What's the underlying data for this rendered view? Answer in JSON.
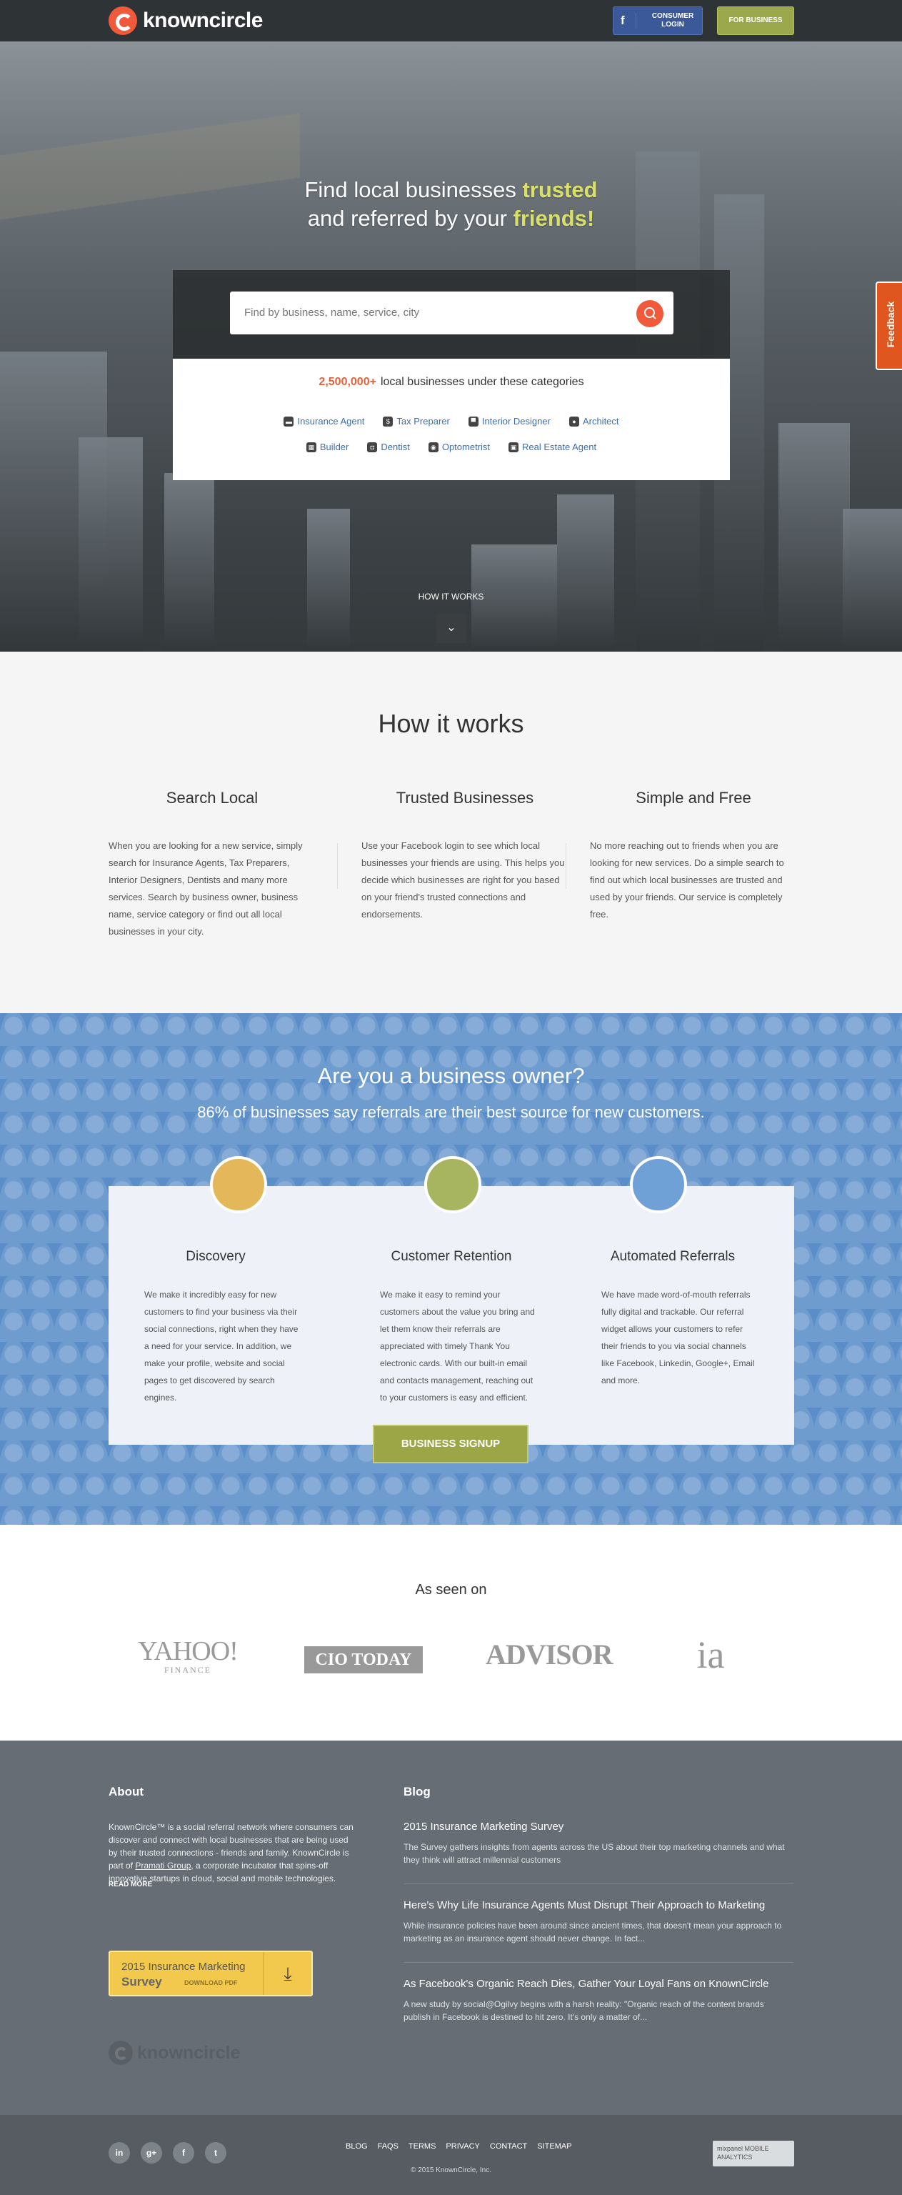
{
  "nav": {
    "logo_text": "knowncircle",
    "fb_label": "CONSUMER LOGIN",
    "business_label": "FOR BUSINESS"
  },
  "hero": {
    "title_part1": "Find local businesses ",
    "title_highlight1": "trusted",
    "title_part2": "and referred by your ",
    "title_highlight2": "friends!",
    "search_placeholder": "Find by business, name, service, city",
    "count": "2,500,000+",
    "count_text": "local businesses under these categories",
    "categories_row1": [
      "Insurance Agent",
      "Tax Preparer",
      "Interior Designer",
      "Architect"
    ],
    "categories_row2": [
      "Builder",
      "Dentist",
      "Optometrist",
      "Real Estate Agent"
    ],
    "how_link": "HOW IT WORKS",
    "feedback": "Feedback"
  },
  "how": {
    "title": "How it works",
    "columns": [
      {
        "title": "Search Local",
        "text": "When you are looking for a new service, simply search for Insurance Agents, Tax Preparers, Interior Designers, Dentists and many more services. Search by business owner, business name, service category or find out all local businesses in your city."
      },
      {
        "title": "Trusted Businesses",
        "text": "Use your Facebook login to see which local businesses your friends are using. This helps you decide which businesses are right for you based on your friend's trusted connections and endorsements."
      },
      {
        "title": "Simple and Free",
        "text": "No more reaching out to friends when you are looking for new services. Do a simple search to find out which local businesses are trusted and used by your friends. Our service is completely free."
      }
    ]
  },
  "owner": {
    "title": "Are you a business owner?",
    "subtitle": "86% of businesses say referrals are their best source for new customers.",
    "features": [
      {
        "title": "Discovery",
        "text": "We make it incredibly easy for new customers to find your business via their social connections, right when they have a need for your service. In addition, we make your profile, website and social pages to get discovered by search engines.",
        "color": "#e4b85a"
      },
      {
        "title": "Customer Retention",
        "text": "We make it easy to remind your customers about the value you bring and let them know their referrals are appreciated with timely Thank You electronic cards. With our built-in email and contacts management, reaching out to your customers is easy and efficient.",
        "color": "#a8b560"
      },
      {
        "title": "Automated Referrals",
        "text": "We have made word-of-mouth referrals fully digital and trackable. Our referral widget allows your customers to refer their friends to you via social channels like Facebook, Linkedin, Google+, Email and more.",
        "color": "#6fa0d6"
      }
    ],
    "signup_label": "BUSINESS SIGNUP"
  },
  "seen": {
    "title": "As seen on",
    "logos": {
      "yahoo": "YAHOO!",
      "yahoo_sub": "FINANCE",
      "cio": "CIO TODAY",
      "advisor": "ADVISOR",
      "ia": "ia"
    }
  },
  "footer": {
    "about_title": "About",
    "about_text_1": "KnownCircle™ is a social referral network where consumers can discover and connect with local businesses that are being used by their trusted connections - friends and family. KnownCircle is part of ",
    "about_link": "Pramati Group",
    "about_text_2": ", a corporate incubator that spins-off innovative startups in cloud, social and mobile technologies.",
    "read_more": "READ MORE",
    "download_line1": "2015 Insurance Marketing",
    "download_line2": "Survey",
    "download_cta": "DOWNLOAD PDF",
    "logo_text": "knowncircle",
    "blog_title": "Blog",
    "posts": [
      {
        "title": "2015 Insurance Marketing Survey",
        "text": "The Survey gathers insights from agents across the US about their top marketing channels and what they think will attract millennial customers"
      },
      {
        "title": "Here's Why Life Insurance Agents Must Disrupt Their Approach to Marketing",
        "text": "While insurance policies have been around since ancient times, that doesn't mean your approach to marketing as an insurance agent should never change. In fact..."
      },
      {
        "title": "As Facebook's Organic Reach Dies, Gather Your Loyal Fans on KnownCircle",
        "text": "A new study by social@Ogilvy begins with a harsh reality: \"Organic reach of the content brands publish in Facebook is destined to hit zero. It's only a matter of..."
      }
    ],
    "links": [
      "BLOG",
      "FAQS",
      "TERMS",
      "PRIVACY",
      "CONTACT",
      "SITEMAP"
    ],
    "social": [
      "in",
      "g+",
      "f",
      "t"
    ],
    "copyright": "© 2015 KnownCircle, Inc.",
    "mixpanel": "mixpanel MOBILE ANALYTICS"
  }
}
